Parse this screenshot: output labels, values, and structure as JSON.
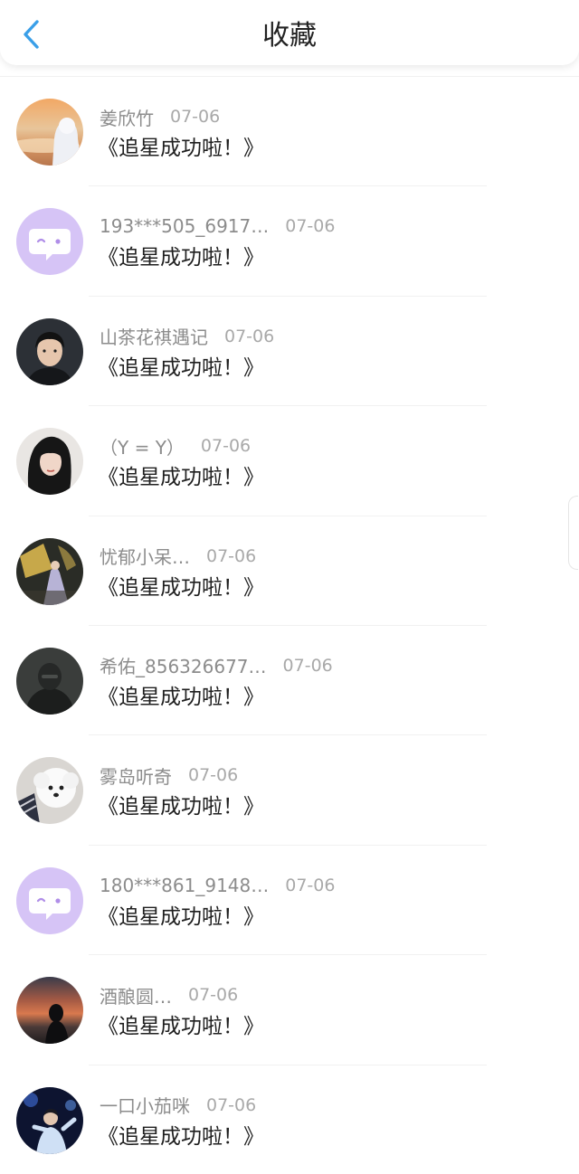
{
  "header": {
    "title": "收藏",
    "back_icon": "chevron-left-icon",
    "accent_color": "#3a9fe8"
  },
  "items": [
    {
      "name": "姜欣竹",
      "date": "07-06",
      "text": "《追星成功啦！》",
      "avatar": "photo-sunset-hoodie"
    },
    {
      "name": "193***505_6917…",
      "date": "07-06",
      "text": "《追星成功啦！》",
      "avatar": "default-chat-bubble"
    },
    {
      "name": "山茶花祺遇记",
      "date": "07-06",
      "text": "《追星成功啦！》",
      "avatar": "photo-boy-portrait"
    },
    {
      "name": "（Y = Y）",
      "date": "07-06",
      "text": "《追星成功啦！》",
      "avatar": "photo-girl-portrait"
    },
    {
      "name": "忧郁小呆…",
      "date": "07-06",
      "text": "《追星成功啦！》",
      "avatar": "photo-gold-dress"
    },
    {
      "name": "希佑_856326677…",
      "date": "07-06",
      "text": "《追星成功啦！》",
      "avatar": "photo-dark-figure"
    },
    {
      "name": "雾岛听奇",
      "date": "07-06",
      "text": "《追星成功啦！》",
      "avatar": "photo-white-dog"
    },
    {
      "name": "180***861_9148…",
      "date": "07-06",
      "text": "《追星成功啦！》",
      "avatar": "default-chat-bubble"
    },
    {
      "name": "酒酿圆…",
      "date": "07-06",
      "text": "《追星成功啦！》",
      "avatar": "photo-sunset-silhouette"
    },
    {
      "name": "一口小茄咪",
      "date": "07-06",
      "text": "《追星成功啦！》",
      "avatar": "photo-stage-singer"
    }
  ]
}
